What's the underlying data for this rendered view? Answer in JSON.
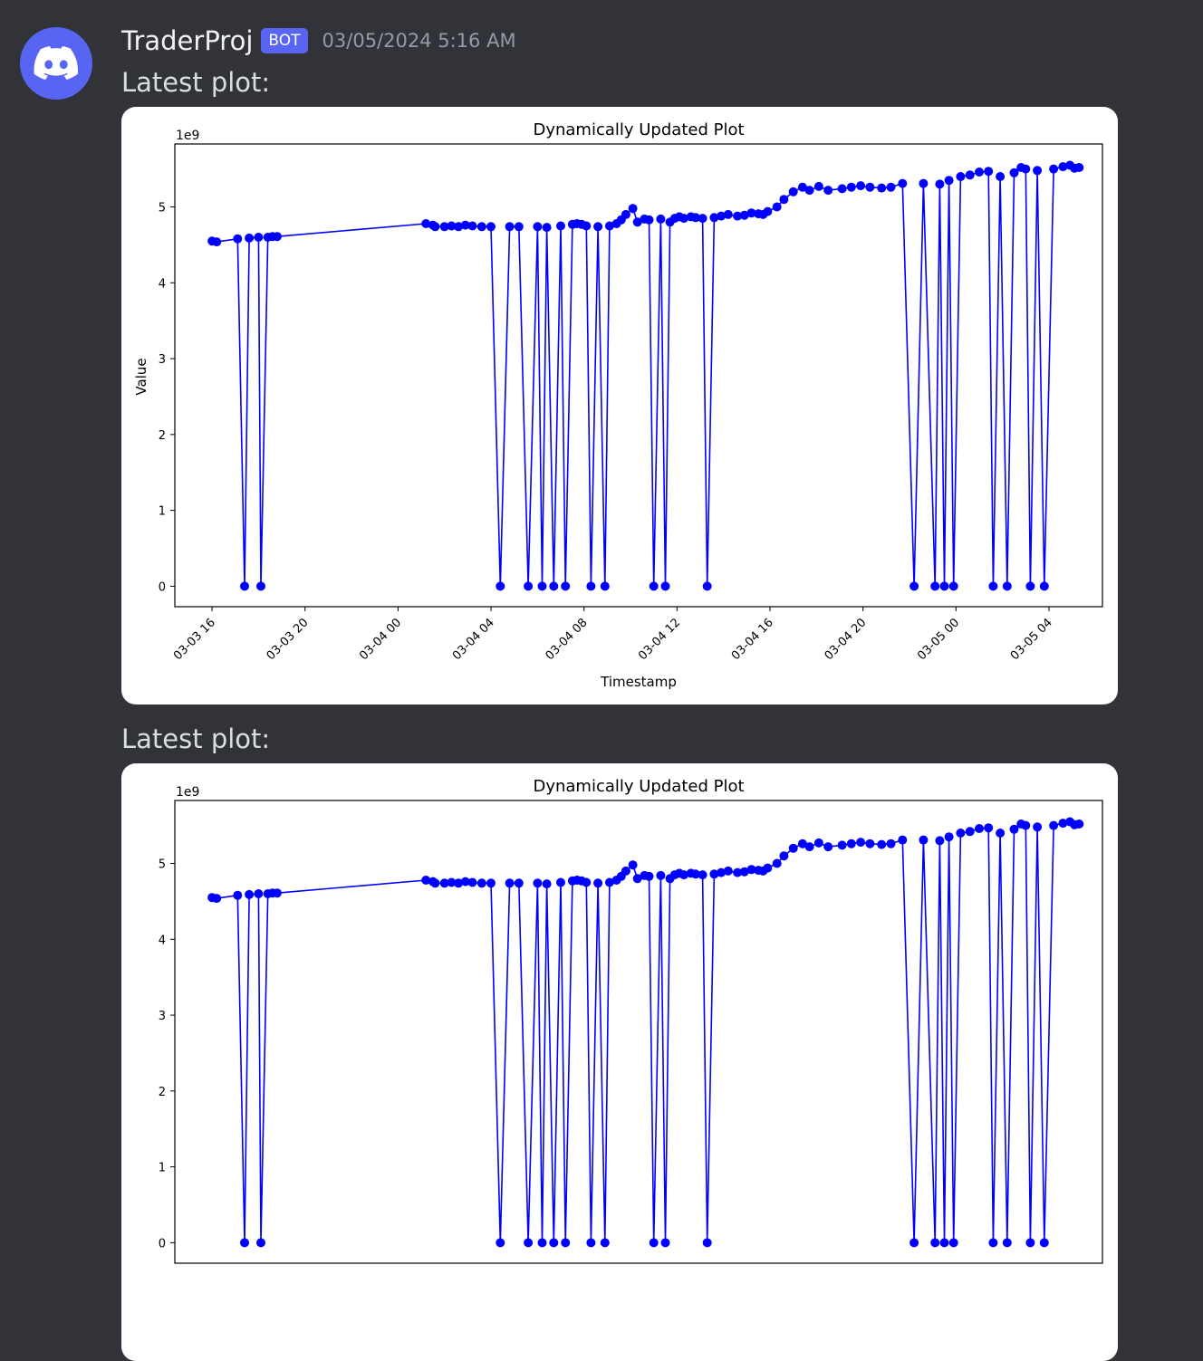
{
  "message": {
    "author": "TraderProj",
    "badge": "BOT",
    "timestamp": "03/05/2024 5:16 AM",
    "avatar_icon": "discord-logo-icon",
    "avatar_color": "#5865f2"
  },
  "posts": [
    {
      "text": "Latest plot:"
    },
    {
      "text": "Latest plot:"
    }
  ],
  "chart_data": [
    {
      "type": "line",
      "title": "Dynamically Updated Plot",
      "xlabel": "Timestamp",
      "ylabel": "Value",
      "y_scale_label": "1e9",
      "x_range_hours": [
        -1.6,
        38.3
      ],
      "ylim": [
        -0.27,
        5.83
      ],
      "x_ticks": [
        "03-03 16",
        "03-03 20",
        "03-04 00",
        "03-04 04",
        "03-04 08",
        "03-04 12",
        "03-04 16",
        "03-04 20",
        "03-05 00",
        "03-05 04"
      ],
      "y_ticks": [
        "0",
        "1",
        "2",
        "3",
        "4",
        "5"
      ],
      "color": "#0000ff",
      "marker": "circle",
      "x_hours": [
        0.0,
        0.2,
        1.1,
        1.4,
        1.6,
        2.0,
        2.1,
        2.4,
        2.6,
        2.8,
        9.2,
        9.5,
        9.6,
        10.0,
        10.3,
        10.6,
        10.9,
        11.2,
        11.6,
        12.0,
        12.4,
        12.8,
        13.2,
        13.6,
        14.0,
        14.2,
        14.4,
        14.7,
        15.0,
        15.2,
        15.5,
        15.7,
        15.9,
        16.1,
        16.3,
        16.6,
        16.9,
        17.1,
        17.4,
        17.6,
        17.8,
        18.1,
        18.3,
        18.6,
        18.8,
        19.0,
        19.3,
        19.5,
        19.7,
        19.9,
        20.1,
        20.3,
        20.6,
        20.8,
        21.1,
        21.3,
        21.6,
        21.9,
        22.2,
        22.6,
        22.9,
        23.2,
        23.5,
        23.7,
        23.9,
        24.3,
        24.6,
        25.0,
        25.4,
        25.7,
        26.1,
        26.5,
        27.1,
        27.5,
        27.9,
        28.3,
        28.8,
        29.2,
        29.7,
        30.2,
        30.6,
        31.1,
        31.3,
        31.5,
        31.7,
        31.9,
        32.2,
        32.6,
        33.0,
        33.4,
        33.6,
        33.9,
        34.2,
        34.5,
        34.8,
        35.0,
        35.2,
        35.5,
        35.8,
        36.2,
        36.6,
        36.9,
        37.1,
        37.3
      ],
      "values": [
        4.55,
        4.54,
        4.58,
        0.0,
        4.59,
        4.6,
        0.0,
        4.6,
        4.61,
        4.61,
        4.78,
        4.76,
        4.74,
        4.74,
        4.75,
        4.74,
        4.76,
        4.75,
        4.74,
        4.74,
        0.0,
        4.74,
        4.74,
        0.0,
        4.74,
        0.0,
        4.73,
        0.0,
        4.75,
        0.0,
        4.77,
        4.78,
        4.77,
        4.75,
        0.0,
        4.74,
        0.0,
        4.75,
        4.78,
        4.83,
        4.9,
        4.98,
        4.8,
        4.84,
        4.83,
        0.0,
        4.84,
        0.0,
        4.8,
        4.85,
        4.87,
        4.85,
        4.87,
        4.86,
        4.85,
        0.0,
        4.86,
        4.88,
        4.9,
        4.88,
        4.89,
        4.92,
        4.91,
        4.9,
        4.94,
        5.0,
        5.1,
        5.2,
        5.26,
        5.22,
        5.27,
        5.22,
        5.24,
        5.26,
        5.28,
        5.26,
        5.25,
        5.26,
        5.31,
        0.0,
        5.31,
        0.0,
        5.3,
        0.0,
        5.35,
        0.0,
        5.4,
        5.42,
        5.46,
        5.47,
        0.0,
        5.4,
        0.0,
        5.45,
        5.52,
        5.5,
        0.0,
        5.48,
        0.0,
        5.5,
        5.53,
        5.55,
        5.51,
        5.52
      ]
    },
    {
      "type": "line",
      "title": "Dynamically Updated Plot",
      "y_scale_label": "1e9",
      "y_ticks": [
        "5"
      ],
      "color": "#0000ff",
      "note_visible": "partially visible, same series"
    }
  ]
}
